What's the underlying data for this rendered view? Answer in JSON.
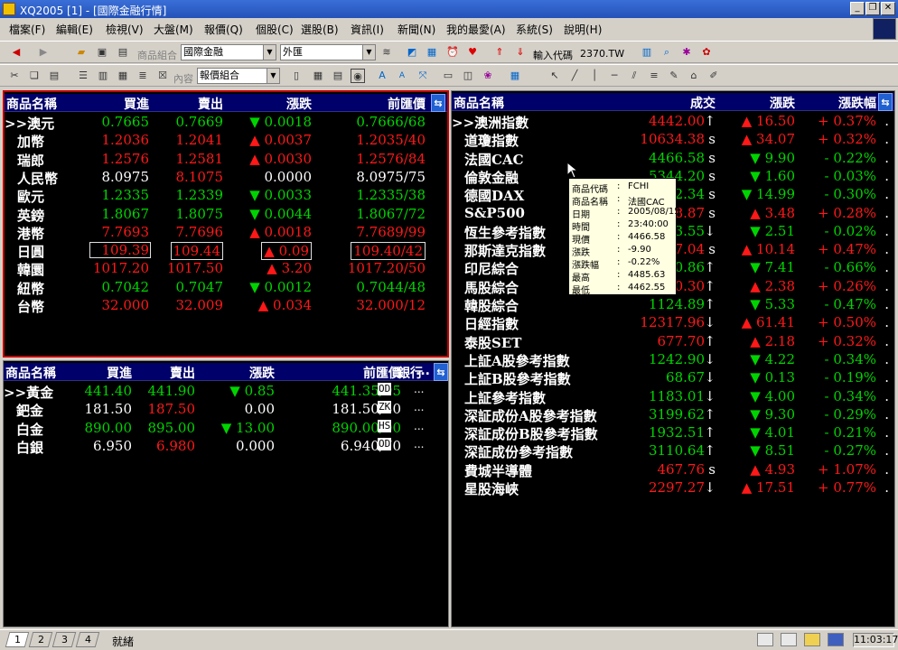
{
  "window": {
    "title": "XQ2005 [1] - [國際金融行情]"
  },
  "menu": [
    "檔案(F)",
    "編輯(E)",
    "檢視(V)",
    "大盤(M)",
    "報價(Q)",
    "個股(C)",
    "選股(B)",
    "資訊(I)",
    "新聞(N)",
    "我的最愛(A)",
    "系統(S)",
    "說明(H)"
  ],
  "toolbar": {
    "group_label": "商品組合",
    "group_value": "國際金融",
    "category_value": "外匯",
    "code_label": "輸入代碼",
    "code_value": "2370.TW",
    "content_label": "內容",
    "content_value": "報價組合"
  },
  "fx": {
    "headers": [
      "商品名稱",
      "買進",
      "賣出",
      "漲跌",
      "前匯價"
    ],
    "rows": [
      {
        "name": ">>澳元",
        "bid": "0.7665",
        "ask": "0.7669",
        "chg": "▼ 0.0018",
        "prev": "0.7666/68",
        "c": "g"
      },
      {
        "name": "加幣",
        "bid": "1.2036",
        "ask": "1.2041",
        "chg": "▲ 0.0037",
        "prev": "1.2035/40",
        "c": "r"
      },
      {
        "name": "瑞郎",
        "bid": "1.2576",
        "ask": "1.2581",
        "chg": "▲ 0.0030",
        "prev": "1.2576/84",
        "c": "r"
      },
      {
        "name": "人民幣",
        "bid": "8.0975",
        "ask": "8.1075",
        "chg": "0.0000",
        "prev": "8.0975/75",
        "c": "w",
        "ask_c": "r"
      },
      {
        "name": "歐元",
        "bid": "1.2335",
        "ask": "1.2339",
        "chg": "▼ 0.0033",
        "prev": "1.2335/38",
        "c": "g"
      },
      {
        "name": "英鎊",
        "bid": "1.8067",
        "ask": "1.8075",
        "chg": "▼ 0.0044",
        "prev": "1.8067/72",
        "c": "g"
      },
      {
        "name": "港幣",
        "bid": "7.7693",
        "ask": "7.7696",
        "chg": "▲ 0.0018",
        "prev": "7.7689/99",
        "c": "r"
      },
      {
        "name": "日圓",
        "bid": "109.39",
        "ask": "109.44",
        "chg": "▲ 0.09",
        "prev": "109.40/42",
        "c": "r",
        "boxed": true
      },
      {
        "name": "韓圜",
        "bid": "1017.20",
        "ask": "1017.50",
        "chg": "▲ 3.20",
        "prev": "1017.20/50",
        "c": "r"
      },
      {
        "name": "紐幣",
        "bid": "0.7042",
        "ask": "0.7047",
        "chg": "▼ 0.0012",
        "prev": "0.7044/48",
        "c": "g"
      },
      {
        "name": "台幣",
        "bid": "32.000",
        "ask": "32.009",
        "chg": "▲ 0.034",
        "prev": "32.000/12",
        "c": "r"
      }
    ]
  },
  "metals": {
    "headers": [
      "商品名稱",
      "買進",
      "賣出",
      "漲跌",
      "前匯價",
      "銀行",
      "..."
    ],
    "rows": [
      {
        "name": ">>黃金",
        "bid": "441.40",
        "ask": "441.90",
        "chg": "▼ 0.85",
        "prev": "441.35/95",
        "bank": "OD",
        "c": "g"
      },
      {
        "name": "鈀金",
        "bid": "181.50",
        "ask": "187.50",
        "chg": "0.00",
        "prev": "181.50/50",
        "bank": "ZK",
        "c": "w",
        "ask_c": "r"
      },
      {
        "name": "白金",
        "bid": "890.00",
        "ask": "895.00",
        "chg": "▼ 13.00",
        "prev": "890.00/00",
        "bank": "HS",
        "c": "g"
      },
      {
        "name": "白銀",
        "bid": "6.950",
        "ask": "6.980",
        "chg": "0.000",
        "prev": "6.940/70",
        "bank": "OD",
        "c": "w",
        "ask_c": "r"
      }
    ]
  },
  "indices": {
    "headers": [
      "商品名稱",
      "成交",
      "漲跌",
      "漲跌幅"
    ],
    "rows": [
      {
        "name": ">>澳洲指數",
        "price": "4442.00",
        "mark": "↑",
        "chg": "▲ 16.50",
        "pct": "+ 0.37%",
        "c": "r"
      },
      {
        "name": "道瓊指數",
        "price": "10634.38",
        "mark": "s",
        "chg": "▲ 34.07",
        "pct": "+ 0.32%",
        "c": "r"
      },
      {
        "name": "法國CAC",
        "price": "4466.58",
        "mark": "s",
        "chg": "▼ 9.90",
        "pct": "- 0.22%",
        "c": "g"
      },
      {
        "name": "倫敦金融",
        "price": "5344.20",
        "mark": "s",
        "chg": "▼ 1.60",
        "pct": "- 0.03%",
        "c": "g"
      },
      {
        "name": "德國DAX",
        "price": "4312.34",
        "mark": "s",
        "chg": "▼ 14.99",
        "pct": "- 0.30%",
        "c": "g"
      },
      {
        "name": "S&P500",
        "price": "1228.87",
        "mark": "s",
        "chg": "▲ 3.48",
        "pct": "+ 0.28%",
        "c": "r"
      },
      {
        "name": "恆生參考指數",
        "price": "14223.55",
        "mark": "↓",
        "chg": "▼ 2.51",
        "pct": "- 0.02%",
        "c": "g"
      },
      {
        "name": "那斯達克指數",
        "price": "2157.04",
        "mark": "s",
        "chg": "▲ 10.14",
        "pct": "+ 0.47%",
        "c": "r"
      },
      {
        "name": "印尼綜合",
        "price": "1120.86",
        "mark": "↑",
        "chg": "▼ 7.41",
        "pct": "- 0.66%",
        "c": "g"
      },
      {
        "name": "馬股綜合",
        "price": "920.30",
        "mark": "↑",
        "chg": "▲ 2.38",
        "pct": "+ 0.26%",
        "c": "r"
      },
      {
        "name": "韓股綜合",
        "price": "1124.89",
        "mark": "↑",
        "chg": "▼ 5.33",
        "pct": "- 0.47%",
        "c": "g"
      },
      {
        "name": "日經指數",
        "price": "12317.96",
        "mark": "↓",
        "chg": "▲ 61.41",
        "pct": "+ 0.50%",
        "c": "r"
      },
      {
        "name": "泰股SET",
        "price": "677.70",
        "mark": "↑",
        "chg": "▲ 2.18",
        "pct": "+ 0.32%",
        "c": "r"
      },
      {
        "name": "上証A股參考指數",
        "price": "1242.90",
        "mark": "↓",
        "chg": "▼ 4.22",
        "pct": "- 0.34%",
        "c": "g"
      },
      {
        "name": "上証B股參考指數",
        "price": "68.67",
        "mark": "↓",
        "chg": "▼ 0.13",
        "pct": "- 0.19%",
        "c": "g"
      },
      {
        "name": "上証參考指數",
        "price": "1183.01",
        "mark": "↓",
        "chg": "▼ 4.00",
        "pct": "- 0.34%",
        "c": "g"
      },
      {
        "name": "深証成份A股參考指數",
        "price": "3199.62",
        "mark": "↑",
        "chg": "▼ 9.30",
        "pct": "- 0.29%",
        "c": "g"
      },
      {
        "name": "深証成份B股參考指數",
        "price": "1932.51",
        "mark": "↑",
        "chg": "▼ 4.01",
        "pct": "- 0.21%",
        "c": "g"
      },
      {
        "name": "深証成份參考指數",
        "price": "3110.64",
        "mark": "↑",
        "chg": "▼ 8.51",
        "pct": "- 0.27%",
        "c": "g"
      },
      {
        "name": "費城半導體",
        "price": "467.76",
        "mark": "s",
        "chg": "▲ 4.93",
        "pct": "+ 1.07%",
        "c": "r"
      },
      {
        "name": "星股海峽",
        "price": "2297.27",
        "mark": "↓",
        "chg": "▲ 17.51",
        "pct": "+ 0.77%",
        "c": "r"
      }
    ]
  },
  "tooltip": [
    {
      "k": "商品代碼",
      "v": "FCHI"
    },
    {
      "k": "商品名稱",
      "v": "法國CAC"
    },
    {
      "k": "日期",
      "v": "2005/08/15"
    },
    {
      "k": "時間",
      "v": "23:40:00"
    },
    {
      "k": "現價",
      "v": "4466.58"
    },
    {
      "k": "漲跌",
      "v": "-9.90"
    },
    {
      "k": "漲跌幅",
      "v": "-0.22%"
    },
    {
      "k": "最高",
      "v": "4485.63"
    },
    {
      "k": "最低",
      "v": "4462.55"
    }
  ],
  "status": {
    "tabs": [
      "1",
      "2",
      "3",
      "4"
    ],
    "text": "就緒",
    "time": "11:03:17"
  },
  "colors": {
    "up": "#ff1818",
    "down": "#00d400",
    "header": "#00006a",
    "active_border": "#c00000"
  }
}
